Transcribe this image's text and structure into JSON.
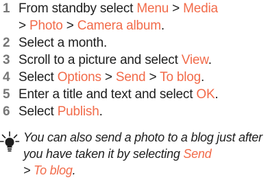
{
  "steps": [
    {
      "num": "1",
      "parts": [
        {
          "text": "From standby select ",
          "hl": false
        },
        {
          "text": "Menu",
          "hl": true
        },
        {
          "text": " > ",
          "hl": false
        },
        {
          "text": "Media",
          "hl": true
        },
        {
          "text": " > ",
          "hl": false
        },
        {
          "text": "Photo",
          "hl": true
        },
        {
          "text": " > ",
          "hl": false
        },
        {
          "text": "Camera album",
          "hl": true
        },
        {
          "text": ".",
          "hl": false
        }
      ]
    },
    {
      "num": "2",
      "parts": [
        {
          "text": "Select a month.",
          "hl": false
        }
      ]
    },
    {
      "num": "3",
      "parts": [
        {
          "text": "Scroll to a picture and select ",
          "hl": false
        },
        {
          "text": "View",
          "hl": true
        },
        {
          "text": ".",
          "hl": false
        }
      ]
    },
    {
      "num": "4",
      "parts": [
        {
          "text": "Select ",
          "hl": false
        },
        {
          "text": "Options",
          "hl": true
        },
        {
          "text": " > ",
          "hl": false
        },
        {
          "text": "Send",
          "hl": true
        },
        {
          "text": " > ",
          "hl": false
        },
        {
          "text": "To blog",
          "hl": true
        },
        {
          "text": ".",
          "hl": false
        }
      ]
    },
    {
      "num": "5",
      "parts": [
        {
          "text": "Enter a title and text and select ",
          "hl": false
        },
        {
          "text": "OK",
          "hl": true
        },
        {
          "text": ".",
          "hl": false
        }
      ]
    },
    {
      "num": "6",
      "parts": [
        {
          "text": "Select ",
          "hl": false
        },
        {
          "text": "Publish",
          "hl": true
        },
        {
          "text": ".",
          "hl": false
        }
      ]
    }
  ],
  "tip": {
    "icon": "lightbulb-icon",
    "parts": [
      {
        "text": "You can also send a photo to a blog just after you have taken it by selecting ",
        "hl": false
      },
      {
        "text": "Send",
        "hl": true
      },
      {
        "text": " > ",
        "hl": false
      },
      {
        "text": "To blog",
        "hl": true
      },
      {
        "text": ".",
        "hl": false
      }
    ]
  },
  "colors": {
    "text": "#1e1e1e",
    "step_number": "#777777",
    "highlight": "#f26b4a"
  }
}
